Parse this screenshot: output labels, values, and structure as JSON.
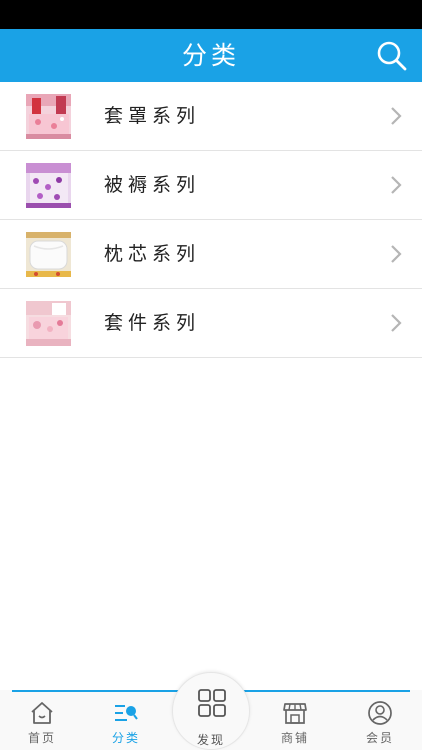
{
  "header": {
    "title": "分类",
    "search_icon": "search-icon"
  },
  "categories": [
    {
      "label": "套罩系列",
      "thumb": "pink-bedding-photo"
    },
    {
      "label": "被褥系列",
      "thumb": "purple-bedding-photo"
    },
    {
      "label": "枕芯系列",
      "thumb": "pillow-photo"
    },
    {
      "label": "套件系列",
      "thumb": "pink-bedroom-photo"
    }
  ],
  "tabbar": {
    "tabs": [
      {
        "label": "首页",
        "icon": "home-icon"
      },
      {
        "label": "分类",
        "icon": "category-icon"
      },
      {
        "label": "发现",
        "icon": "grid-icon"
      },
      {
        "label": "商铺",
        "icon": "store-icon"
      },
      {
        "label": "会员",
        "icon": "user-icon"
      }
    ],
    "active": "分类"
  },
  "colors": {
    "accent": "#1aa2e6",
    "status_bar": "#000000",
    "divider": "#e3e3e3"
  }
}
